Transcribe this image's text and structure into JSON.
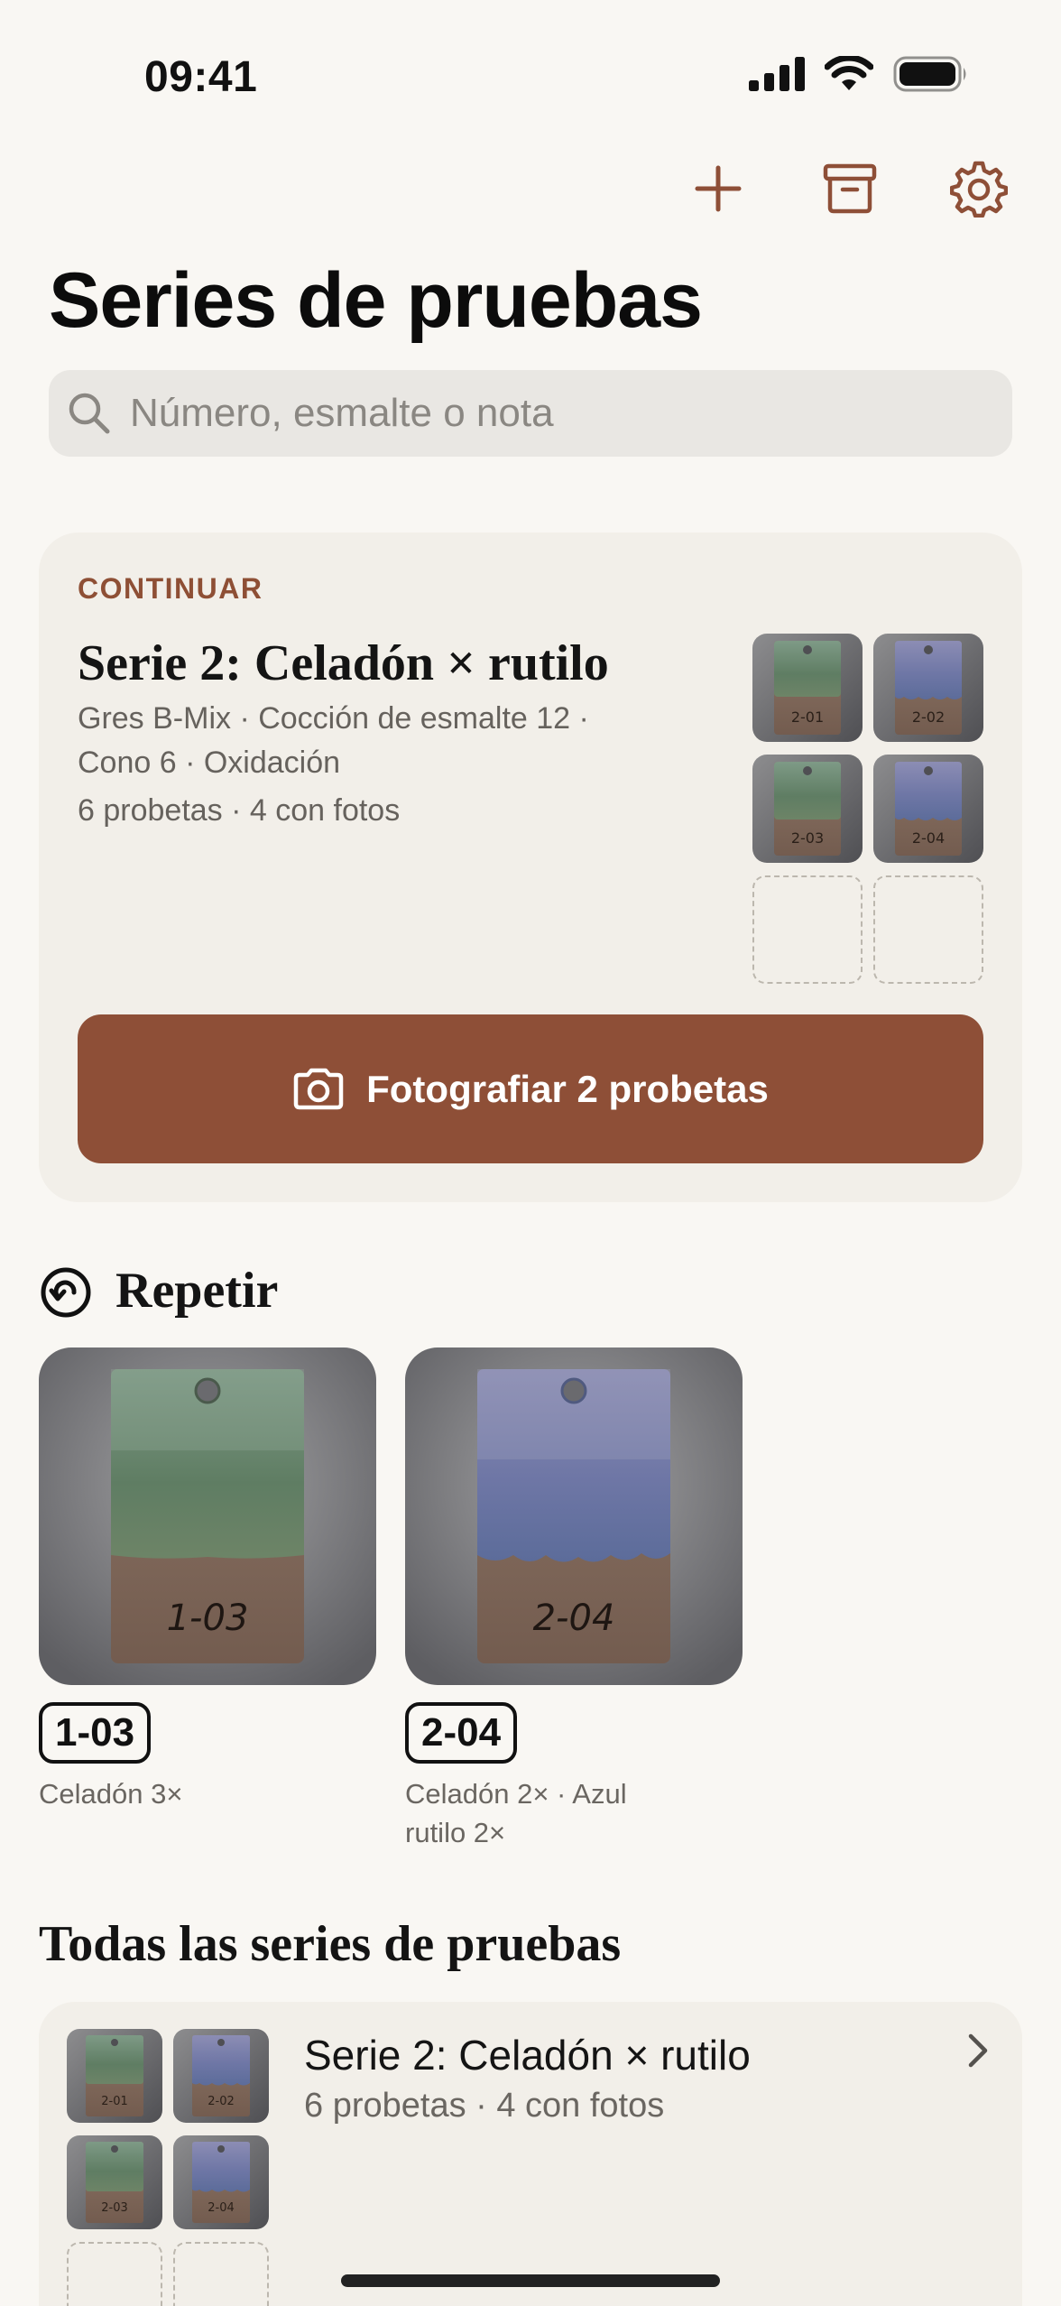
{
  "status_bar": {
    "time": "09:41"
  },
  "toolbar": {
    "add_icon": "plus-icon",
    "archive_icon": "archive-icon",
    "settings_icon": "gear-icon"
  },
  "page": {
    "title": "Series de pruebas"
  },
  "search": {
    "placeholder": "Número, esmalte o nota",
    "value": ""
  },
  "continue_card": {
    "eyebrow": "CONTINUAR",
    "title": "Serie 2: Celadón × rutilo",
    "meta_line1": "Gres B-Mix · Cocción de esmalte 12 ·",
    "meta_line2": "Cono 6 · Oxidación",
    "meta_line3": "6 probetas · 4 con fotos",
    "thumbs": [
      "2-01",
      "2-02",
      "2-03",
      "2-04"
    ],
    "cta_label": "Fotografiar 2 probetas"
  },
  "repeat": {
    "heading": "Repetir",
    "items": [
      {
        "code": "1-03",
        "caption": "Celadón 3×"
      },
      {
        "code": "2-04",
        "caption": "Celadón 2× · Azul rutilo 2×"
      }
    ]
  },
  "all_series": {
    "heading": "Todas las series de pruebas",
    "items": [
      {
        "title": "Serie 2: Celadón × rutilo",
        "subtitle": "6 probetas · 4 con fotos",
        "thumbs": [
          "2-01",
          "2-02",
          "2-03",
          "2-04"
        ]
      }
    ]
  },
  "colors": {
    "accent": "#8e4f37",
    "background": "#f9f7f3",
    "card": "#f2efe9"
  }
}
